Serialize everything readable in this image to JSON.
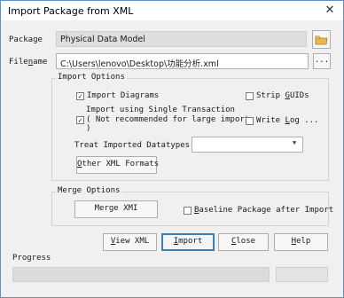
{
  "window": {
    "title": "Import Package from XML",
    "close_glyph": "✕"
  },
  "package": {
    "label": "Package",
    "value": "Physical Data Model"
  },
  "filename": {
    "label": "Filename",
    "value": "C:\\Users\\lenovo\\Desktop\\功能分析.xml",
    "browse_label": "..."
  },
  "import_options": {
    "title": "Import Options",
    "import_diagrams": {
      "label": "Import Diagrams",
      "checked": true
    },
    "strip_guids": {
      "label": "Strip GUIDs",
      "checked": false
    },
    "single_transaction": {
      "line1": "Import using Single Transaction",
      "line2": "( Not recommended for large imports",
      "line3": ")",
      "checked": true
    },
    "write_log": {
      "label": "Write Log ...",
      "checked": false
    },
    "datatypes_label": "Treat Imported Datatypes as",
    "datatypes_value": "",
    "other_formats_label": "Other XML Formats"
  },
  "merge_options": {
    "title": "Merge Options",
    "merge_label": "Merge XMI",
    "baseline": {
      "label": "Baseline Package after Import",
      "checked": false
    }
  },
  "buttons": {
    "view_xml": "View XML",
    "import": "Import",
    "close": "Close",
    "help": "Help"
  },
  "progress": {
    "label": "Progress",
    "value": 0
  },
  "colors": {
    "accent": "#3c7fb1",
    "folder_icon": "#e8b84a"
  }
}
